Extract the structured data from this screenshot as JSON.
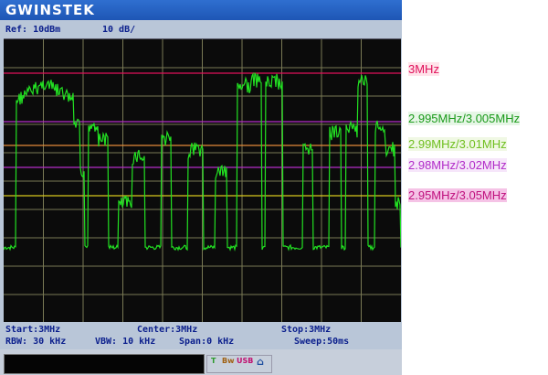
{
  "header": {
    "brand": "GWINSTEK"
  },
  "info": {
    "ref": "Ref: 10dBm",
    "scale": "10 dB/"
  },
  "bottom": {
    "start": "Start:3MHz",
    "center": "Center:3MHz",
    "stop": "Stop:3MHz",
    "rbw": "RBW: 30 kHz",
    "vbw": "VBW: 10 kHz",
    "span": "Span:0 kHz",
    "sweep": "Sweep:50ms"
  },
  "status_icons": [
    {
      "name": "trigger-icon",
      "glyph": "T"
    },
    {
      "name": "bw-icon",
      "glyph": "Bw"
    },
    {
      "name": "usb-icon",
      "glyph": "USB"
    },
    {
      "name": "home-icon",
      "glyph": "⌂"
    }
  ],
  "annotations": [
    {
      "text": "3MHz",
      "color": "#e0105a",
      "bg": "#ffe3ea"
    },
    {
      "text": "2.995MHz/3.005MHz",
      "color": "#1a9a1a",
      "bg": "#e6f6e6"
    },
    {
      "text": "2.99MHz/3.01MHz",
      "color": "#6fbf1f",
      "bg": "#f0f8e4"
    },
    {
      "text": "2.98MHz/3.02MHz",
      "color": "#b22cc8",
      "bg": "#f6e6fa"
    },
    {
      "text": "2.95MHz/3.05MHz",
      "color": "#c0107e",
      "bg": "#f5c3e6"
    }
  ],
  "colors": {
    "trace": "#22e022",
    "grid": "#7a7a55",
    "screen": "#0b0b0b",
    "lines": [
      "#e0105a",
      "#b22cc8",
      "#e38a3a",
      "#b22cc8",
      "#d8c81e"
    ]
  }
}
